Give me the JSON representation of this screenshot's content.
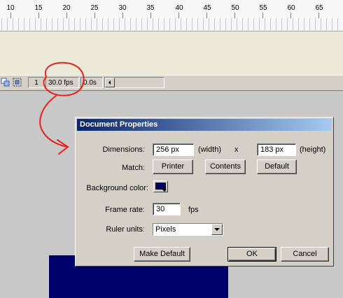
{
  "ruler": {
    "ticks": [
      "10",
      "15",
      "20",
      "25",
      "30",
      "35",
      "40",
      "45",
      "50",
      "55",
      "60",
      "65"
    ]
  },
  "statusbar": {
    "frame": "1",
    "fps": "30.0 fps",
    "time": "0.0s"
  },
  "dialog": {
    "title": "Document Properties",
    "dimensions": {
      "label": "Dimensions:",
      "width_value": "256 px",
      "width_suffix": "(width)",
      "x": "x",
      "height_value": "183 px",
      "height_suffix": "(height)"
    },
    "match": {
      "label": "Match:",
      "printer": "Printer",
      "contents": "Contents",
      "default": "Default"
    },
    "background": {
      "label": "Background color:",
      "color": "#00006b"
    },
    "frame_rate": {
      "label": "Frame rate:",
      "value": "30",
      "unit": "fps"
    },
    "ruler_units": {
      "label": "Ruler units:",
      "selected": "Pixels"
    },
    "buttons": {
      "make_default": "Make Default",
      "ok": "OK",
      "cancel": "Cancel"
    }
  },
  "colors": {
    "stage": "#00006b",
    "annotation": "#e8201a",
    "titlebar_start": "#0a246a",
    "titlebar_end": "#a6caf0"
  }
}
